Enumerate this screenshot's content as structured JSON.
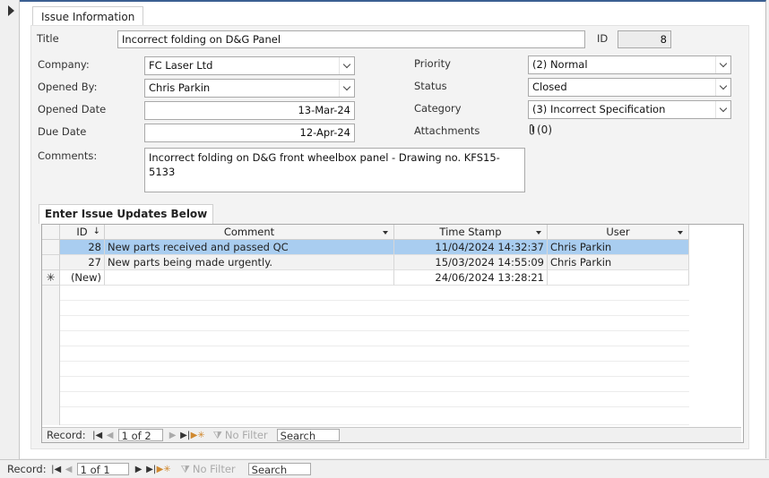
{
  "tab": {
    "label": "Issue Information"
  },
  "fields": {
    "title": {
      "label": "Title",
      "value": "Incorrect folding on D&G Panel"
    },
    "id": {
      "label": "ID",
      "value": "8"
    },
    "company": {
      "label": "Company:",
      "value": "FC Laser Ltd"
    },
    "opened_by": {
      "label": "Opened By:",
      "value": "Chris Parkin"
    },
    "opened_date": {
      "label": "Opened Date",
      "value": "13-Mar-24"
    },
    "due_date": {
      "label": "Due Date",
      "value": "12-Apr-24"
    },
    "comments": {
      "label": "Comments:",
      "value": "Incorrect folding on D&G front wheelbox panel - Drawing no. KFS15-5133"
    },
    "priority": {
      "label": "Priority",
      "value": "(2) Normal"
    },
    "status": {
      "label": "Status",
      "value": "Closed"
    },
    "category": {
      "label": "Category",
      "value": "(3) Incorrect Specification"
    },
    "attachments": {
      "label": "Attachments",
      "value": "(0)"
    }
  },
  "subform": {
    "label": "Enter Issue Updates Below",
    "columns": [
      "ID",
      "Comment",
      "Time Stamp",
      "User"
    ],
    "rows": [
      {
        "id": "28",
        "comment": "New parts received and passed QC",
        "timestamp": "11/04/2024 14:32:37",
        "user": "Chris Parkin"
      },
      {
        "id": "27",
        "comment": "New parts being made urgently.",
        "timestamp": "15/03/2024 14:55:09",
        "user": "Chris Parkin"
      }
    ],
    "new_row": {
      "marker": "✳",
      "id": "(New)",
      "timestamp": "24/06/2024 13:28:21"
    },
    "nav": {
      "label": "Record:",
      "position": "1 of 2",
      "filter": "No Filter",
      "search": "Search"
    }
  },
  "main_nav": {
    "label": "Record:",
    "position": "1 of 1",
    "filter": "No Filter",
    "search": "Search"
  },
  "colors": {
    "accent": "#3b5f92",
    "selected_row": "#a9cdf0"
  }
}
